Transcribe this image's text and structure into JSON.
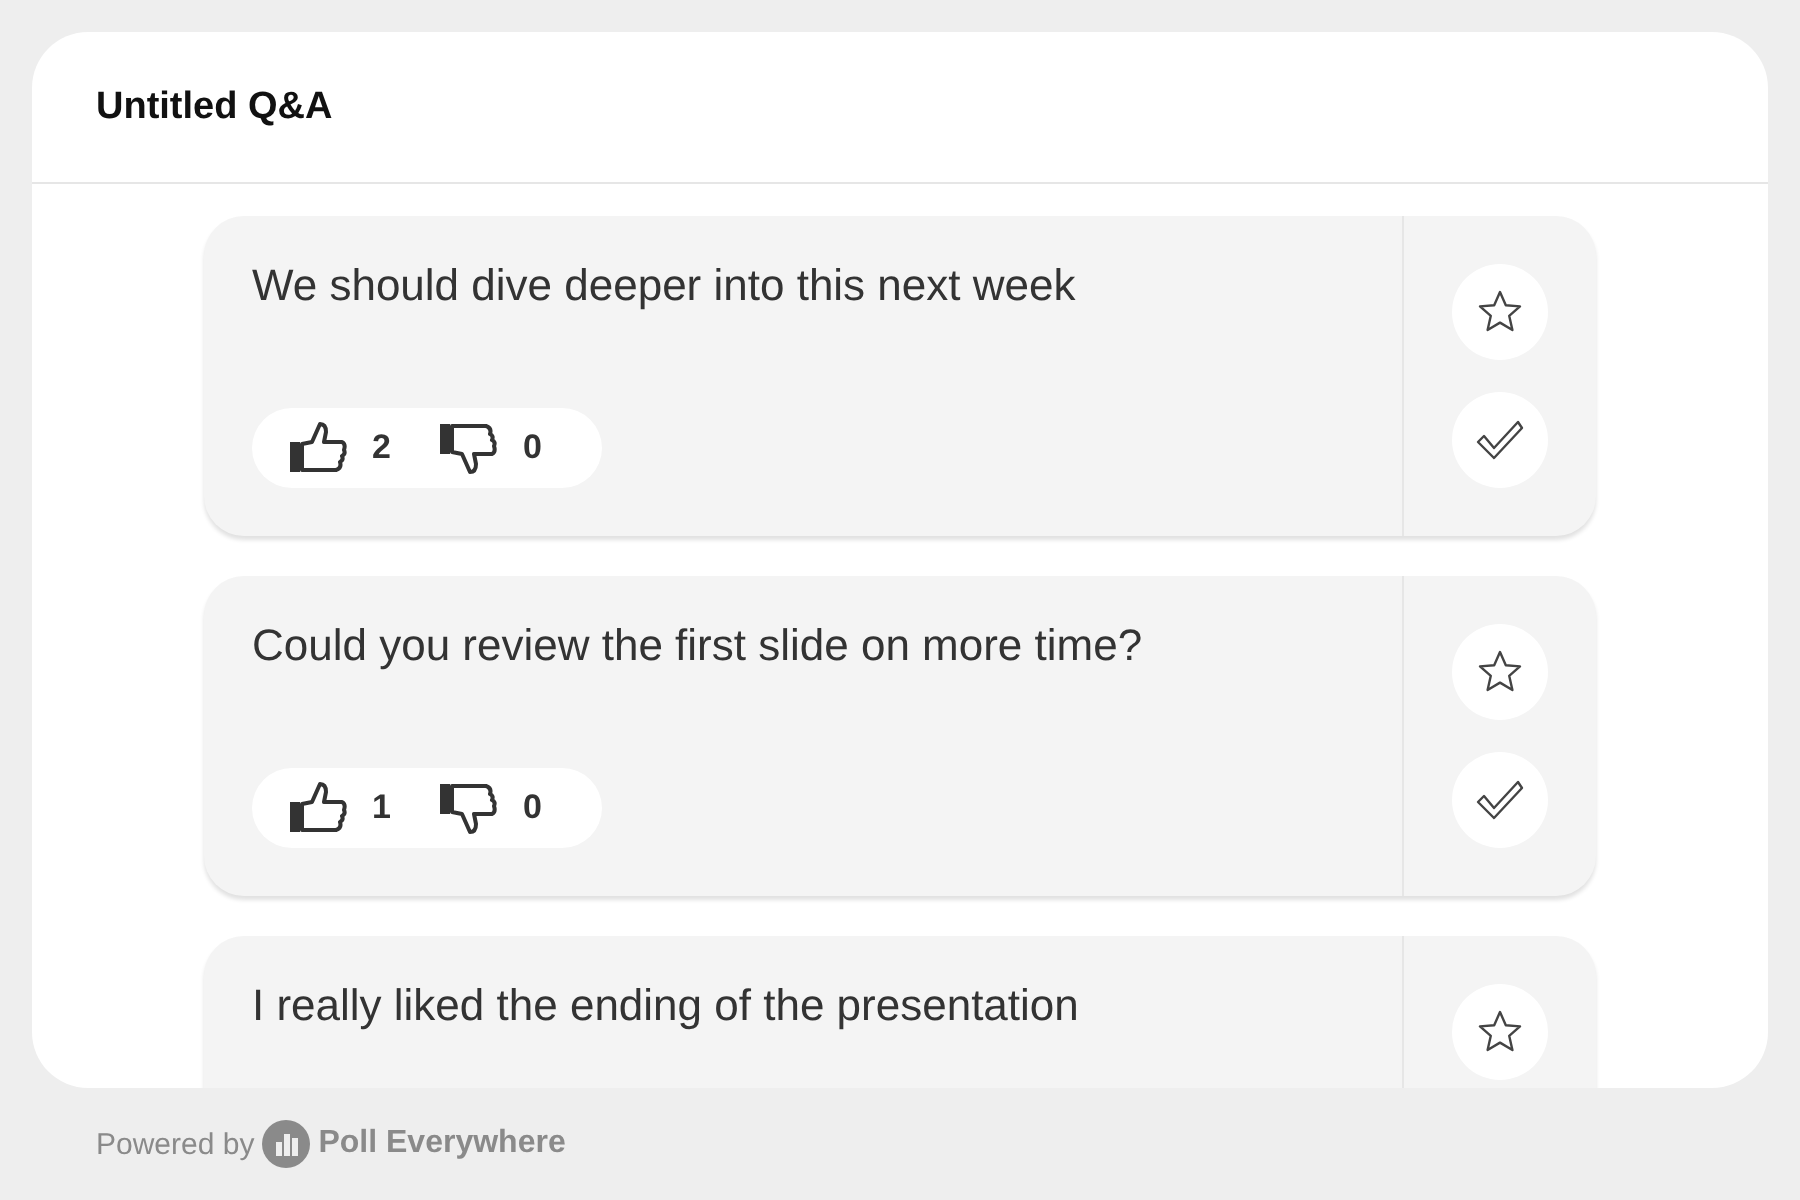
{
  "title": "Untitled Q&A",
  "questions": [
    {
      "text": "We should dive deeper into this next week",
      "likes": "2",
      "dislikes": "0",
      "actions": [
        {
          "kind": "star"
        },
        {
          "kind": "check"
        }
      ]
    },
    {
      "text": "Could you review the first slide on more time?",
      "likes": "1",
      "dislikes": "0",
      "actions": [
        {
          "kind": "star"
        },
        {
          "kind": "check"
        }
      ]
    },
    {
      "text": "I really liked the ending of the presentation",
      "actions": [
        {
          "kind": "star"
        }
      ]
    }
  ],
  "footer": {
    "prefix": "Powered by",
    "brand": "Poll Everywhere"
  }
}
